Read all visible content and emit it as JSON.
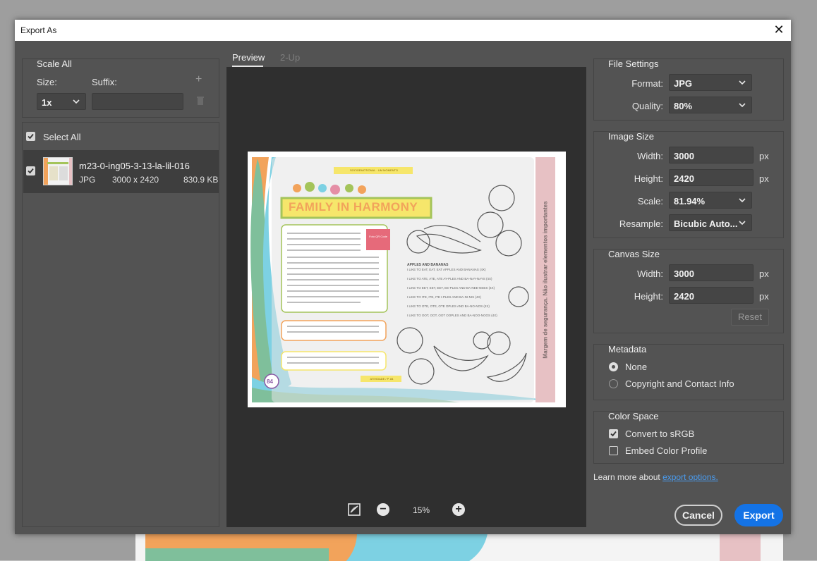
{
  "window": {
    "title": "Export As"
  },
  "scale_all": {
    "title": "Scale All",
    "size_label": "Size:",
    "suffix_label": "Suffix:",
    "size_value": "1x",
    "suffix_value": ""
  },
  "asset_list": {
    "select_all_label": "Select All",
    "items": [
      {
        "name": "m23-0-ing05-3-13-la-lil-016",
        "format": "JPG",
        "dimensions": "3000 x 2420",
        "file_size": "830.9 KB",
        "checked": true
      }
    ]
  },
  "preview": {
    "tabs": [
      {
        "label": "Preview",
        "active": true
      },
      {
        "label": "2-Up",
        "active": false
      }
    ],
    "zoom": "15%",
    "artboard": {
      "heading": "FAMILY IN HARMONY",
      "top_banner": "SOCIOEMOTIONAL · UM MOMENTO",
      "qr_label": "Foto QR Code",
      "fruit_section": "APPLES AND BANANAS",
      "lines": [
        "I LIKE TO EAT, EAT, EAT APPLES AND BANANAS (4X)",
        "I LIKE TO ATE, ATE, ATE AY-PLES AND BA-NAY-NAYS (4X)",
        "I LIKE TO EET, EET, EET, EE-PLES AND BA-NEE-NEES (4X)",
        "I LIKE TO ITE, ITE, ITE I-PLES AND BA-NI-NIS (4X)",
        "I LIKE TO OTE, OTE, OTE OPLES AND BA-NO-NOS (4X)",
        "I LIKE TO OOT, OOT, OOT OOPLES AND BA-NOO-NOOS (4X)"
      ],
      "side_text": "Margem de segurança. Não ilustrar elementos importantes",
      "page_number": "84",
      "footer_tag": "ATIVIDADE / P. 84"
    }
  },
  "file_settings": {
    "title": "File Settings",
    "format_label": "Format:",
    "format_value": "JPG",
    "quality_label": "Quality:",
    "quality_value": "80%"
  },
  "image_size": {
    "title": "Image Size",
    "width_label": "Width:",
    "width_value": "3000",
    "height_label": "Height:",
    "height_value": "2420",
    "scale_label": "Scale:",
    "scale_value": "81.94%",
    "resample_label": "Resample:",
    "resample_value": "Bicubic Auto...",
    "unit": "px"
  },
  "canvas_size": {
    "title": "Canvas Size",
    "width_label": "Width:",
    "width_value": "3000",
    "height_label": "Height:",
    "height_value": "2420",
    "unit": "px",
    "reset_label": "Reset"
  },
  "metadata": {
    "title": "Metadata",
    "options": [
      {
        "label": "None",
        "selected": true
      },
      {
        "label": "Copyright and Contact Info",
        "selected": false
      }
    ]
  },
  "color_space": {
    "title": "Color Space",
    "convert_label": "Convert to sRGB",
    "convert_checked": true,
    "embed_label": "Embed Color Profile",
    "embed_checked": false
  },
  "footer": {
    "learn_text": "Learn more about",
    "learn_link": "export options.",
    "cancel_label": "Cancel",
    "export_label": "Export"
  },
  "colors": {
    "accent": "#1473e6",
    "link": "#4a9cf0",
    "panel": "#535353",
    "preview_bg": "#2f2f2f"
  }
}
